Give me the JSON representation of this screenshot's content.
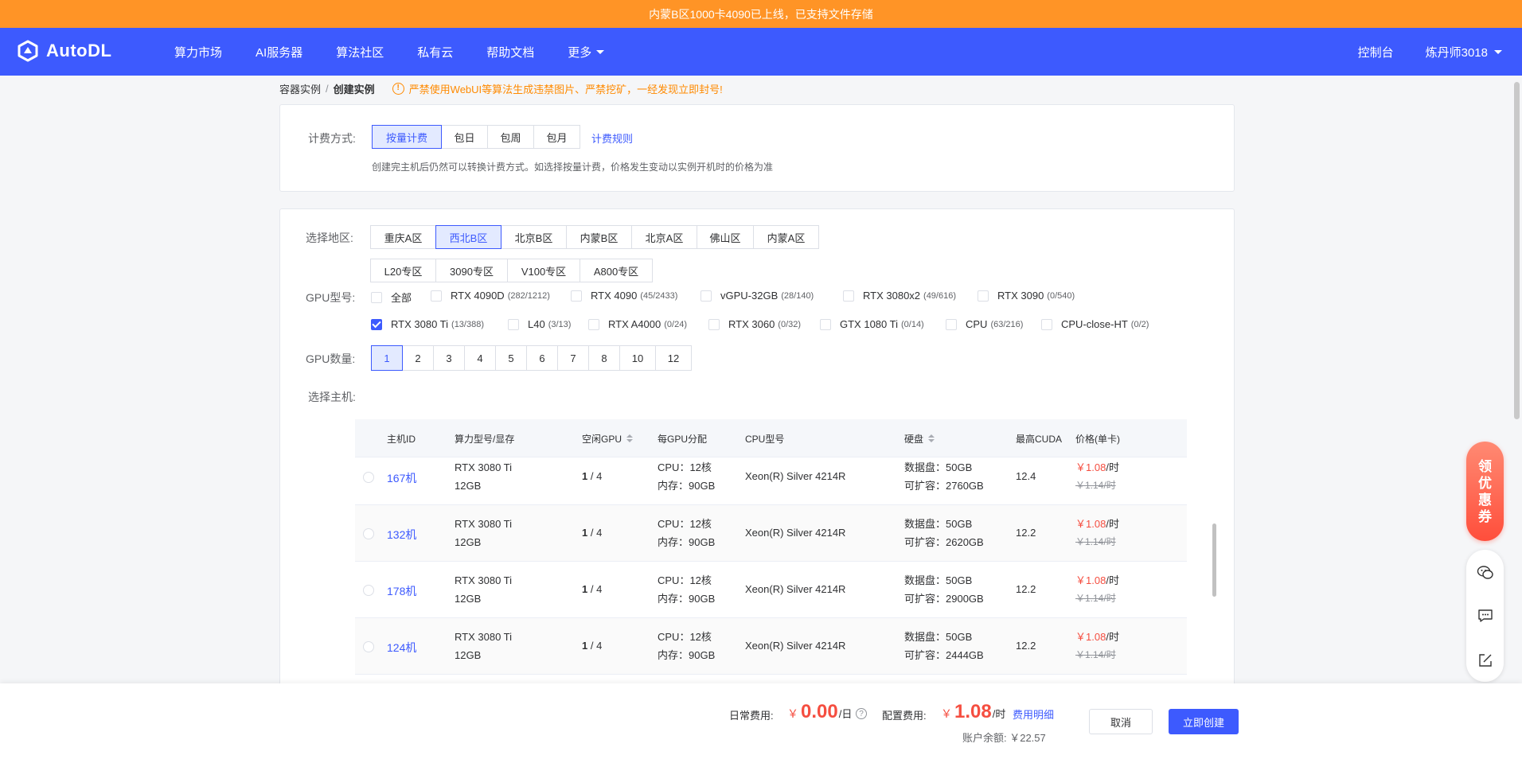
{
  "announcement": "内蒙B区1000卡4090已上线，已支持文件存储",
  "navbar": {
    "logo_text": "AutoDL",
    "items": [
      "算力市场",
      "AI服务器",
      "算法社区",
      "私有云",
      "帮助文档"
    ],
    "more_label": "更多",
    "console_label": "控制台",
    "username": "炼丹师3018"
  },
  "breadcrumb": {
    "parent": "容器实例",
    "separator": "/",
    "current": "创建实例",
    "warning": "严禁使用WebUI等算法生成违禁图片、严禁挖矿，一经发现立即封号!"
  },
  "billing": {
    "label": "计费方式:",
    "options": [
      "按量计费",
      "包日",
      "包周",
      "包月"
    ],
    "selected": "按量计费",
    "rules_link": "计费规则",
    "hint": "创建完主机后仍然可以转换计费方式。如选择按量计费，价格发生变动以实例开机时的价格为准"
  },
  "region": {
    "label": "选择地区:",
    "row1": [
      "重庆A区",
      "西北B区",
      "北京B区",
      "内蒙B区",
      "北京A区",
      "佛山区",
      "内蒙A区"
    ],
    "row2": [
      "L20专区",
      "3090专区",
      "V100专区",
      "A800专区"
    ],
    "selected": "西北B区"
  },
  "gpu_type": {
    "label": "GPU型号:",
    "row1": [
      {
        "name": "全部",
        "count": "",
        "checked": false
      },
      {
        "name": "RTX 4090D",
        "count": "(282/1212)",
        "checked": false
      },
      {
        "name": "RTX 4090",
        "count": "(45/2433)",
        "checked": false
      },
      {
        "name": "vGPU-32GB",
        "count": "(28/140)",
        "checked": false
      },
      {
        "name": "RTX 3080x2",
        "count": "(49/616)",
        "checked": false
      },
      {
        "name": "RTX 3090",
        "count": "(0/540)",
        "checked": false
      }
    ],
    "row2": [
      {
        "name": "RTX 3080 Ti",
        "count": "(13/388)",
        "checked": true
      },
      {
        "name": "L40",
        "count": "(3/13)",
        "checked": false
      },
      {
        "name": "RTX A4000",
        "count": "(0/24)",
        "checked": false
      },
      {
        "name": "RTX 3060",
        "count": "(0/32)",
        "checked": false
      },
      {
        "name": "GTX 1080 Ti",
        "count": "(0/14)",
        "checked": false
      },
      {
        "name": "CPU",
        "count": "(63/216)",
        "checked": false
      },
      {
        "name": "CPU-close-HT",
        "count": "(0/2)",
        "checked": false
      }
    ]
  },
  "gpu_count": {
    "label": "GPU数量:",
    "options": [
      "1",
      "2",
      "3",
      "4",
      "5",
      "6",
      "7",
      "8",
      "10",
      "12"
    ],
    "selected": "1"
  },
  "host_table": {
    "label": "选择主机:",
    "columns": [
      "主机ID",
      "算力型号/显存",
      "空闲GPU",
      "每GPU分配",
      "CPU型号",
      "硬盘",
      "最高CUDA",
      "价格(单卡)"
    ],
    "rows": [
      {
        "id": "167机",
        "gpu": "RTX 3080 Ti",
        "vram": "12GB",
        "free": "1",
        "total": "/ 4",
        "cpu_alloc": "CPU：12核",
        "mem_alloc": "内存：90GB",
        "cpu_model": "Xeon(R) Silver 4214R",
        "disk": "数据盘：50GB",
        "disk_ext": "可扩容：2760GB",
        "cuda": "12.4",
        "price_yen": "￥",
        "price": "1.08",
        "price_unit": "/时",
        "price_old": "￥1.14/时"
      },
      {
        "id": "132机",
        "gpu": "RTX 3080 Ti",
        "vram": "12GB",
        "free": "1",
        "total": "/ 4",
        "cpu_alloc": "CPU：12核",
        "mem_alloc": "内存：90GB",
        "cpu_model": "Xeon(R) Silver 4214R",
        "disk": "数据盘：50GB",
        "disk_ext": "可扩容：2620GB",
        "cuda": "12.2",
        "price_yen": "￥",
        "price": "1.08",
        "price_unit": "/时",
        "price_old": "￥1.14/时"
      },
      {
        "id": "178机",
        "gpu": "RTX 3080 Ti",
        "vram": "12GB",
        "free": "1",
        "total": "/ 4",
        "cpu_alloc": "CPU：12核",
        "mem_alloc": "内存：90GB",
        "cpu_model": "Xeon(R) Silver 4214R",
        "disk": "数据盘：50GB",
        "disk_ext": "可扩容：2900GB",
        "cuda": "12.2",
        "price_yen": "￥",
        "price": "1.08",
        "price_unit": "/时",
        "price_old": "￥1.14/时"
      },
      {
        "id": "124机",
        "gpu": "RTX 3080 Ti",
        "vram": "12GB",
        "free": "1",
        "total": "/ 4",
        "cpu_alloc": "CPU：12核",
        "mem_alloc": "内存：90GB",
        "cpu_model": "Xeon(R) Silver 4214R",
        "disk": "数据盘：50GB",
        "disk_ext": "可扩容：2444GB",
        "cuda": "12.2",
        "price_yen": "￥",
        "price": "1.08",
        "price_unit": "/时",
        "price_old": "￥1.14/时"
      }
    ]
  },
  "coupon": [
    "领",
    "优",
    "惠",
    "券"
  ],
  "footer": {
    "daily_label": "日常费用:",
    "daily_yen": "￥",
    "daily_value": "0.00",
    "daily_unit": "/日",
    "config_label": "配置费用:",
    "config_yen": "￥",
    "config_value": "1.08",
    "config_unit": "/时",
    "detail_link": "费用明细",
    "balance": "账户余额: ￥22.57",
    "cancel": "取消",
    "create": "立即创建"
  },
  "colors": {
    "primary": "#3d5afe",
    "announce": "#ff9426",
    "price": "#f54e40"
  }
}
